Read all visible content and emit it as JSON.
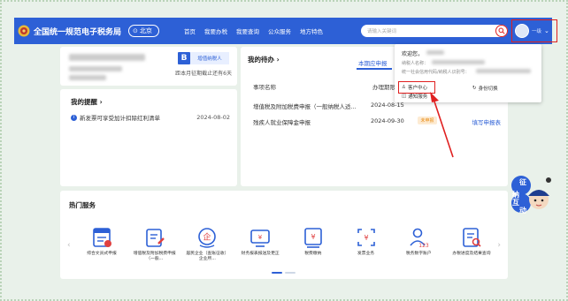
{
  "header": {
    "site_title": "全国统一规范电子税务局",
    "region": "北京",
    "nav": [
      "首页",
      "我要办税",
      "我要查询",
      "公众服务",
      "地方特色"
    ],
    "search_placeholder": "请输入关键词",
    "user_name": "一级"
  },
  "summary_card": {
    "taxpayer_badge": "B",
    "taxpayer_type": "增值纳税人",
    "deadline_text": "距本月征期截止还有6天"
  },
  "reminder": {
    "title": "我的提醒",
    "items": [
      {
        "text": "新发票可享受加计扣除红利清单",
        "date": "2024-08-02"
      }
    ]
  },
  "todo": {
    "title": "我的待办",
    "tab": "本期应申报",
    "columns": [
      "事项名称",
      "办理期限"
    ],
    "rows": [
      {
        "name": "增值税及附加税费申报（一般纳税人适...",
        "date": "2024-08-15",
        "status": "",
        "action": ""
      },
      {
        "name": "残疾人就业保障金申报",
        "date": "2024-09-30",
        "status": "未申报",
        "action": "填写申报表"
      }
    ]
  },
  "dropdown": {
    "greeting": "欢迎您，",
    "line1": "纳税人名称：",
    "line2": "统一社会信用代码/纳税人识别号：",
    "customer_center": "客户中心",
    "notice_service": "通知服务",
    "switch_identity": "身份切换"
  },
  "hot_services": {
    "title": "热门服务",
    "items": [
      {
        "icon": "tax-return-icon",
        "label": "综合文员式申报"
      },
      {
        "icon": "vat-declare-icon",
        "label": "增值税及附加税费申报（一般..."
      },
      {
        "icon": "corp-income-icon",
        "label": "居民企业（查账征收）企业所..."
      },
      {
        "icon": "financial-report-icon",
        "label": "财务报表报送及更正"
      },
      {
        "icon": "invoice-receive-icon",
        "label": "税费缴纳"
      },
      {
        "icon": "invoice-issue-icon",
        "label": "发票业务"
      },
      {
        "icon": "digital-account-icon",
        "label": "税务数字账户"
      },
      {
        "icon": "apply-query-icon",
        "label": "办税进度及结果查询"
      }
    ]
  },
  "mascot": {
    "label": "征纳互动"
  },
  "colors": {
    "brand": "#2d60d6",
    "highlight": "#e02020",
    "background": "#e9f1ea"
  }
}
